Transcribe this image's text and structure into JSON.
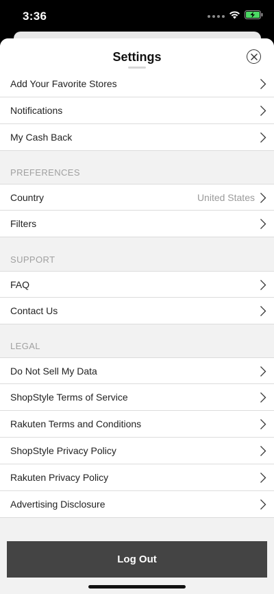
{
  "status_bar": {
    "time": "3:36"
  },
  "header": {
    "title": "Settings"
  },
  "account_rows": [
    {
      "label": "Add Your Favorite Stores"
    },
    {
      "label": "Notifications"
    },
    {
      "label": "My Cash Back"
    }
  ],
  "preferences": {
    "heading": "PREFERENCES",
    "rows": [
      {
        "label": "Country",
        "value": "United States"
      },
      {
        "label": "Filters"
      }
    ]
  },
  "support": {
    "heading": "SUPPORT",
    "rows": [
      {
        "label": "FAQ"
      },
      {
        "label": "Contact Us"
      }
    ]
  },
  "legal": {
    "heading": "LEGAL",
    "rows": [
      {
        "label": "Do Not Sell My Data"
      },
      {
        "label": "ShopStyle Terms of Service"
      },
      {
        "label": "Rakuten Terms and Conditions"
      },
      {
        "label": "ShopStyle Privacy Policy"
      },
      {
        "label": "Rakuten Privacy Policy"
      },
      {
        "label": "Advertising Disclosure"
      }
    ]
  },
  "footer": {
    "logout_label": "Log Out"
  },
  "colors": {
    "button_bg": "#444444",
    "battery": "#4cd964"
  }
}
